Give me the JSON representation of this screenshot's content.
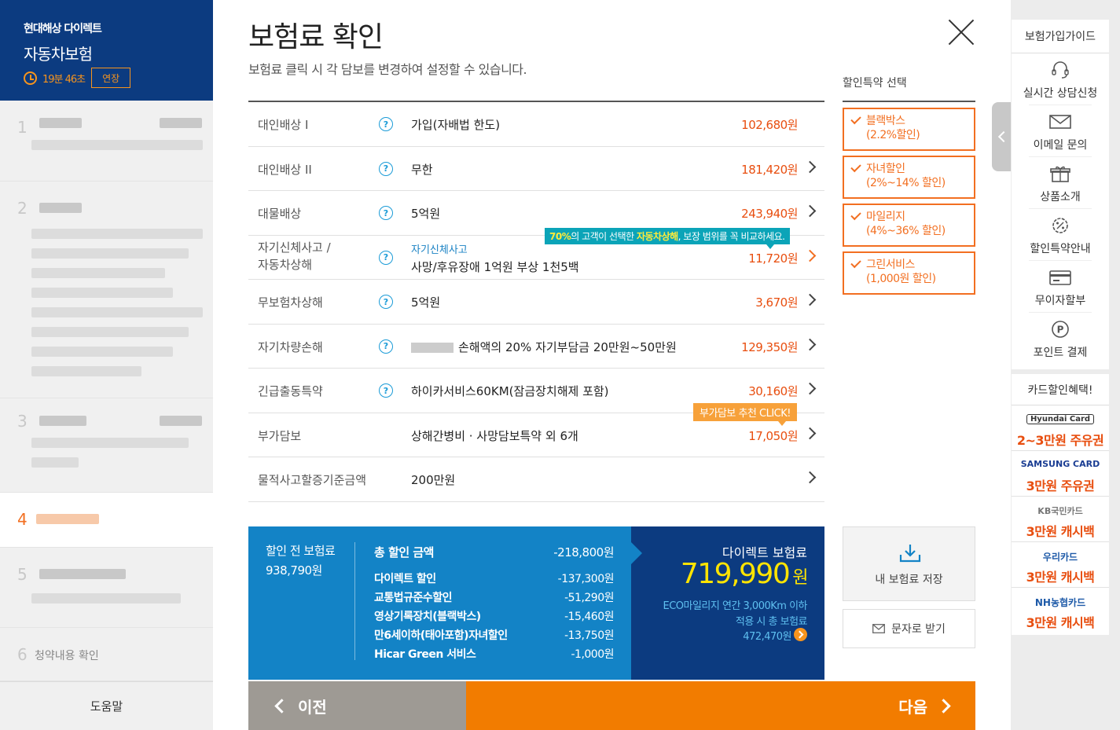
{
  "sidebar": {
    "brand": "현대해상 다이렉트",
    "product": "자동차보험",
    "timer": "19분 46초",
    "extend_label": "연장",
    "steps": [
      {
        "num": "1"
      },
      {
        "num": "2"
      },
      {
        "num": "3"
      },
      {
        "num": "4"
      },
      {
        "num": "5"
      },
      {
        "num": "6",
        "label": "청약내용 확인"
      }
    ],
    "help_label": "도움말"
  },
  "main": {
    "title": "보험료 확인",
    "subtitle": "보험료 클릭 시 각 담보를 변경하여 설정할 수 있습니다.",
    "rows": [
      {
        "label": "대인배상 I",
        "value": "가입(자배법 한도)",
        "price": "102,680원"
      },
      {
        "label": "대인배상 II",
        "value": "무한",
        "price": "181,420원"
      },
      {
        "label": "대물배상",
        "value": "5억원",
        "price": "243,940원"
      },
      {
        "label1": "자기신체사고 /",
        "label2": "자동차상해",
        "sub": "자기신체사고",
        "value": "사망/후유장애 1억원 부상 1천5백",
        "price": "11,720원"
      },
      {
        "label": "무보험차상해",
        "value": "5억원",
        "price": "3,670원"
      },
      {
        "label": "자기차량손해",
        "value": "손해액의 20% 자기부담금 20만원~50만원",
        "price": "129,350원"
      },
      {
        "label": "긴급출동특약",
        "value": "하이카서비스60KM(잠금장치해제 포함)",
        "price": "30,160원"
      },
      {
        "label": "부가담보",
        "value": "상해간병비 · 사망담보특약 외 6개",
        "price": "17,050원"
      },
      {
        "label": "물적사고할증기준금액",
        "value": "200만원"
      }
    ],
    "tip_teal": {
      "pct": "70%",
      "mid": "의 고객이 선택한 ",
      "hl": "자동차상해",
      "end": ", 보장 범위를 꼭 비교하세요."
    },
    "tip_orange": "부가담보 추천 CLICK!",
    "discount_title": "할인특약 선택",
    "discounts": [
      {
        "name": "블랙박스",
        "rate": "(2.2%할인)"
      },
      {
        "name": "자녀할인",
        "rate": "(2%~14% 할인)"
      },
      {
        "name": "마일리지",
        "rate": "(4%~36% 할인)"
      },
      {
        "name": "그린서비스",
        "rate": "(1,000원 할인)"
      }
    ],
    "summary": {
      "pre_label": "할인 전 보험료",
      "pre_value": "938,790원",
      "total_label": "총 할인 금액",
      "total_value": "-218,800원",
      "items": [
        {
          "label": "다이렉트 할인",
          "value": "-137,300원"
        },
        {
          "label": "교통법규준수할인",
          "value": "-51,290원"
        },
        {
          "label": "영상기록장치(블랙박스)",
          "value": "-15,460원"
        },
        {
          "label": "만6세이하(태아포함)자녀할인",
          "value": "-13,750원"
        },
        {
          "label": "Hicar Green 서비스",
          "value": "-1,000원"
        }
      ],
      "direct_label": "다이렉트 보험료",
      "direct_value": "719,990",
      "direct_unit": "원",
      "eco_line1": "ECO마일리지 연간 3,000Km 이하",
      "eco_line2": "적용 시 총 보험료",
      "eco_value": "472,470원"
    },
    "save_label": "내 보험료 저장",
    "sms_label": "문자로 받기",
    "prev_label": "이전",
    "next_label": "다음"
  },
  "right_panel": {
    "guide_title": "보험가입가이드",
    "guide_items": [
      {
        "label": "실시간 상담신청",
        "icon": "headset-icon"
      },
      {
        "label": "이메일 문의",
        "icon": "mail-icon"
      },
      {
        "label": "상품소개",
        "icon": "gift-icon"
      },
      {
        "label": "할인특약안내",
        "icon": "percent-gear-icon"
      },
      {
        "label": "무이자할부",
        "icon": "card-icon"
      },
      {
        "label": "포인트 결제",
        "icon": "point-icon"
      }
    ],
    "card_title": "카드할인혜택!",
    "cards": [
      {
        "logo": "Hyundai Card",
        "benefit": "2~3만원 주유권"
      },
      {
        "logo": "SAMSUNG CARD",
        "benefit": "3만원 주유권"
      },
      {
        "logo": "KB국민카드",
        "benefit": "3만원 캐시백"
      },
      {
        "logo": "우리카드",
        "benefit": "3만원 캐시백"
      },
      {
        "logo": "NH농협카드",
        "benefit": "3만원 캐시백"
      }
    ]
  },
  "colors": {
    "navy": "#0c3b80",
    "blue": "#1383c6",
    "orange": "#f27c00",
    "price": "#e84e0f",
    "yellow": "#ffe400"
  }
}
